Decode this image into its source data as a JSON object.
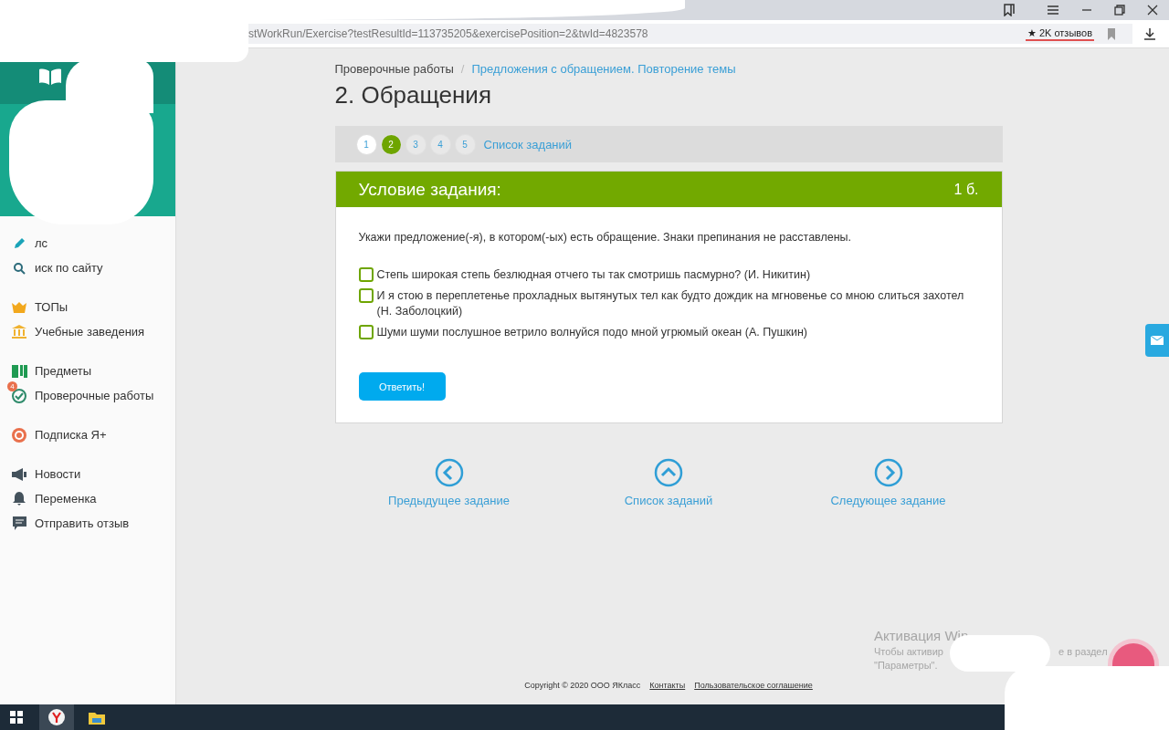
{
  "browser": {
    "url": "stWorkRun/Exercise?testResultId=113735205&exercisePosition=2&twId=4823578",
    "reviews": "★ 2K отзывов"
  },
  "sidebar": {
    "groups": [
      [
        {
          "label": "лс"
        },
        {
          "label": "иск по сайту"
        }
      ],
      [
        {
          "label": "ТОПы"
        },
        {
          "label": "Учебные заведения"
        }
      ],
      [
        {
          "label": "Предметы"
        },
        {
          "label": "Проверочные работы",
          "badge": "4"
        }
      ],
      [
        {
          "label": "Подписка Я+"
        }
      ],
      [
        {
          "label": "Новости"
        },
        {
          "label": "Переменка"
        },
        {
          "label": "Отправить отзыв"
        }
      ]
    ]
  },
  "breadcrumb_separator": "/",
  "breadcrumb": [
    {
      "label": "Проверочные работы",
      "link": false
    },
    {
      "label": "Предложения с обращением. Повторение темы",
      "link": true
    }
  ],
  "title": "2. Обращения",
  "pager": {
    "items": [
      {
        "label": "1",
        "selected": false,
        "visited": true
      },
      {
        "label": "2",
        "selected": true,
        "visited": false
      },
      {
        "label": "3",
        "selected": false,
        "visited": false
      },
      {
        "label": "4",
        "selected": false,
        "visited": false
      },
      {
        "label": "5",
        "selected": false,
        "visited": false
      }
    ],
    "link": "Список заданий"
  },
  "task": {
    "header": "Условие задания:",
    "points": "1 б.",
    "question": "Укажи предложение(-я), в котором(-ых) есть обращение. Знаки препинания не расставлены.",
    "options": [
      {
        "text": "Степь широкая степь безлюдная отчего ты так смотришь пасмурно? (И. Никитин)",
        "checked": false
      },
      {
        "text": "И я стою в переплетенье прохладных вытянутых тел как будто дождик на мгновенье со мною слиться захотел (Н. Заболоцкий)",
        "checked": false
      },
      {
        "text": "Шуми шуми послушное ветрило волнуйся подо мной угрюмый океан (А. Пушкин)",
        "checked": false
      }
    ],
    "submit": "Ответить!"
  },
  "nav": [
    {
      "label": "Предыдущее задание",
      "kind": "prev"
    },
    {
      "label": "Список заданий",
      "kind": "list"
    },
    {
      "label": "Следующее задание",
      "kind": "next"
    }
  ],
  "footer": {
    "copyright": "Copyright © 2020 ООО ЯКласс",
    "links": [
      "Контакты",
      "Пользовательское соглашение"
    ]
  },
  "activation": {
    "title": "Активация Win",
    "line_start": "Чтобы активир",
    "line_end": "е в раздел",
    "line_2": "\"Параметры\"."
  }
}
